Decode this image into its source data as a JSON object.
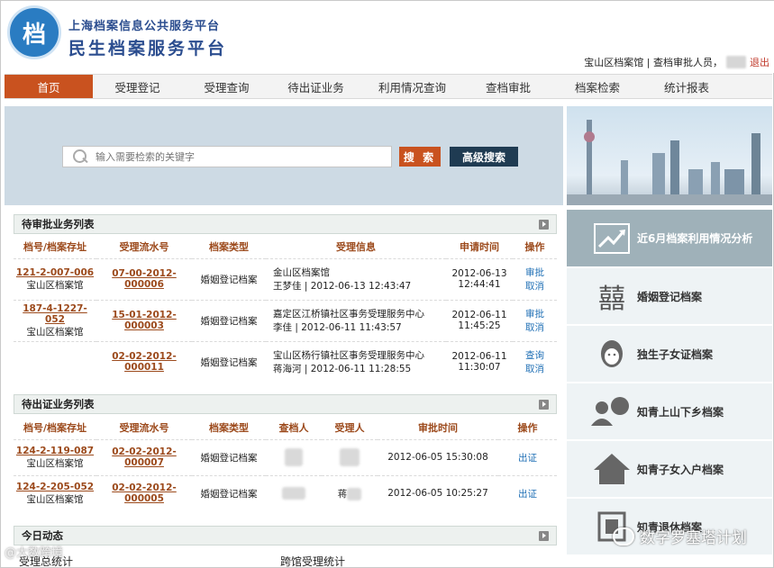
{
  "header": {
    "logo_text": "档",
    "subtitle": "上海档案信息公共服务平台",
    "title": "民生档案服务平台",
    "user_info": "宝山区档案馆 | 查档审批人员，",
    "logout": "退出"
  },
  "nav": [
    {
      "label": "首页",
      "active": true
    },
    {
      "label": "受理登记"
    },
    {
      "label": "受理查询"
    },
    {
      "label": "待出证业务"
    },
    {
      "label": "利用情况查询"
    },
    {
      "label": "查档审批"
    },
    {
      "label": "档案检索"
    },
    {
      "label": "统计报表"
    }
  ],
  "search": {
    "placeholder": "输入需要检索的关键字",
    "search_button": "搜 索",
    "advanced_button": "高级搜索"
  },
  "pending_approval": {
    "title": "待审批业务列表",
    "headers": [
      "档号/档案存址",
      "受理流水号",
      "档案类型",
      "受理信息",
      "申请时间",
      "操作"
    ],
    "rows": [
      {
        "archive_no": "121-2-007-006",
        "location": "宝山区档案馆",
        "flow_no": "07-00-2012-000006",
        "type": "婚姻登记档案",
        "info1": "金山区档案馆",
        "info2": "王梦佳 | 2012-06-13 12:43:47",
        "date": "2012-06-13",
        "time": "12:44:41",
        "action1": "审批",
        "action2": "取消"
      },
      {
        "archive_no": "187-4-1227-052",
        "location": "宝山区档案馆",
        "flow_no": "15-01-2012-000003",
        "type": "婚姻登记档案",
        "info1": "嘉定区江桥镇社区事务受理服务中心",
        "info2": "李佳 | 2012-06-11 11:43:57",
        "date": "2012-06-11",
        "time": "11:45:25",
        "action1": "审批",
        "action2": "取消"
      },
      {
        "archive_no": "",
        "location": "",
        "flow_no": "02-02-2012-000011",
        "type": "婚姻登记档案",
        "info1": "宝山区杨行镇社区事务受理服务中心",
        "info2": "蒋海河 | 2012-06-11 11:28:55",
        "date": "2012-06-11",
        "time": "11:30:07",
        "action1": "查询",
        "action2": "取消"
      }
    ]
  },
  "pending_cert": {
    "title": "待出证业务列表",
    "headers": [
      "档号/档案存址",
      "受理流水号",
      "档案类型",
      "查档人",
      "受理人",
      "审批时间",
      "操作"
    ],
    "rows": [
      {
        "archive_no": "124-2-119-087",
        "location": "宝山区档案馆",
        "flow_no": "02-02-2012-000007",
        "type": "婚姻登记档案",
        "viewer": "",
        "handler": "",
        "time": "2012-06-05 15:30:08",
        "action": "出证"
      },
      {
        "archive_no": "124-2-205-052",
        "location": "宝山区档案馆",
        "flow_no": "02-02-2012-000005",
        "type": "婚姻登记档案",
        "viewer": "",
        "handler": "蒋",
        "time": "2012-06-05 10:25:27",
        "action": "出证"
      }
    ]
  },
  "today": {
    "title": "今日动态",
    "left_label": "受理总统计",
    "right_label": "跨馆受理统计"
  },
  "sidebar": {
    "items": [
      {
        "label": "近6月档案利用情况分析",
        "icon": "chart-trend-icon"
      },
      {
        "label": "婚姻登记档案",
        "icon": "double-happiness-icon"
      },
      {
        "label": "独生子女证档案",
        "icon": "child-face-icon"
      },
      {
        "label": "知青上山下乡档案",
        "icon": "people-chat-icon"
      },
      {
        "label": "知青子女入户档案",
        "icon": "house-icon"
      },
      {
        "label": "知青退休档案",
        "icon": "document-icon"
      }
    ]
  },
  "watermarks": {
    "left": "@大数跨境",
    "right": "数字罗塞塔计划"
  }
}
